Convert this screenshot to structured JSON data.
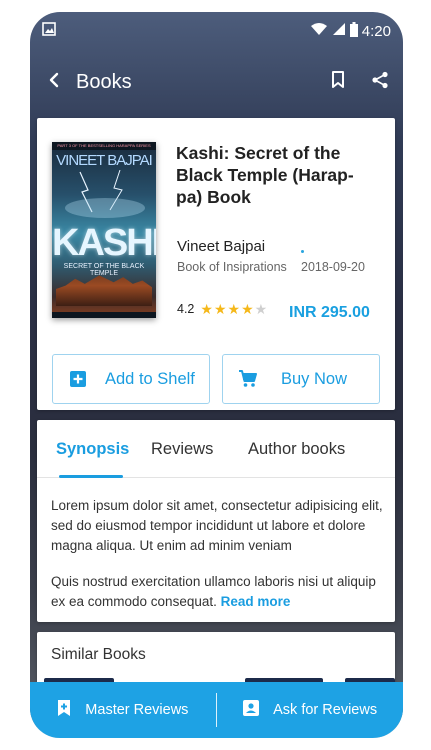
{
  "status_bar": {
    "time": "4:20"
  },
  "app_bar": {
    "title": "Books"
  },
  "book": {
    "cover": {
      "top_strip": "PART 3 OF THE BESTSELLING HARAPPA SERIES",
      "author": "VINEET BAJPAI",
      "title": "KASHI",
      "subtitle": "SECRET OF THE BLACK TEMPLE"
    },
    "title": "Kashi: Secret of the Black Temple (Harap-pa) Book",
    "author": "Vineet Bajpai",
    "publisher": "Book of Insiprations",
    "date": "2018-09-20",
    "rating": "4.2",
    "rating_value": 4.2,
    "stars_max": 5,
    "price": "INR 295.00"
  },
  "actions": {
    "add_to_shelf": "Add to Shelf",
    "buy_now": "Buy Now"
  },
  "tabs": [
    {
      "label": "Synopsis",
      "active": true
    },
    {
      "label": "Reviews",
      "active": false
    },
    {
      "label": "Author books",
      "active": false
    }
  ],
  "synopsis": {
    "p1": "Lorem ipsum dolor sit amet, consectetur adipisicing elit, sed do eiusmod tempor incididunt ut labore et dolore magna aliqua. Ut enim ad minim veniam",
    "p2": "Quis nostrud exercitation ullamco laboris nisi ut aliquip ex ea commodo consequat.",
    "read_more": "Read more"
  },
  "similar": {
    "title": "Similar Books"
  },
  "bottom_bar": {
    "master_reviews": "Master Reviews",
    "ask_reviews": "Ask for Reviews"
  },
  "colors": {
    "accent": "#1a9de0",
    "bottom_bar": "#1ea2e4",
    "star": "#f5b81a"
  },
  "icons": {
    "status": [
      "image-icon",
      "wifi-icon",
      "signal-icon",
      "battery-icon"
    ],
    "app_bar": [
      "back-arrow-icon",
      "bookmark-icon",
      "share-icon"
    ],
    "buttons": [
      "add-box-icon",
      "cart-icon"
    ],
    "bottom_bar": [
      "bookmark-add-icon",
      "account-box-icon"
    ]
  }
}
